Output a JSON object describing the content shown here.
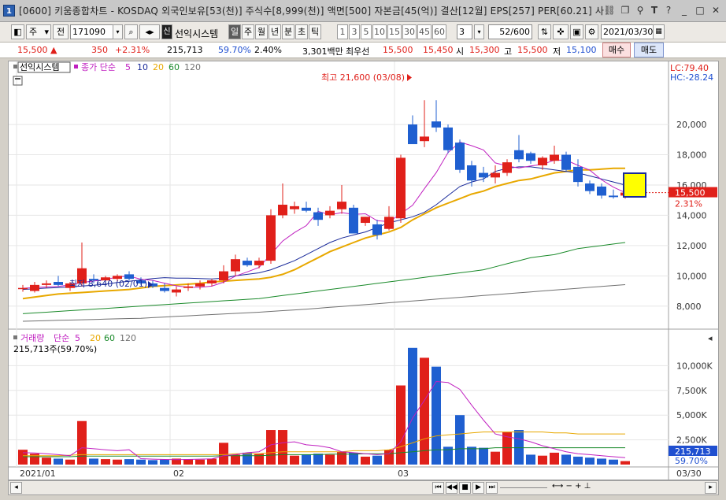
{
  "window": {
    "number_badge": "1",
    "title": "[0600] 키움종합차트 - KOSDAQ 외국인보유[53(천)] 주식수[8,999(천)] 액면[500] 자본금[45(억)] 결산[12월] EPS[257] PER[60.21] 사"
  },
  "toolbar": {
    "period_select": "주",
    "prev_label": "전",
    "code_value": "171090",
    "signal_badge": "신",
    "system_label": "선익시스템",
    "period_tabs": [
      "일",
      "주",
      "월",
      "년",
      "분",
      "초",
      "틱"
    ],
    "selected_period": "일",
    "interval_buttons": [
      "1",
      "3",
      "5",
      "10",
      "15",
      "30",
      "45",
      "60"
    ],
    "interval_value": "3",
    "count_value": "52",
    "count_total": "/600",
    "date_value": "2021/03/30"
  },
  "pricebar": {
    "price": "15,500",
    "change": "350",
    "change_pct": "+2.31%",
    "volume": "215,713",
    "volume_ratio": "59.70%",
    "turnover": "2.40%",
    "amount": "3,301백만",
    "best_ask_label": "최우선",
    "best_ask": "15,500",
    "best_bid": "15,450",
    "open_label": "시",
    "open": "15,300",
    "high_label": "고",
    "high": "15,500",
    "low_label": "저",
    "low": "15,100",
    "buy_label": "매수",
    "sell_label": "매도"
  },
  "legend": {
    "price_name": "선익시스템",
    "price_ma_label": "종가 단순",
    "ma_periods": [
      "5",
      "10",
      "20",
      "60",
      "120"
    ],
    "volume_name": "거래량",
    "volume_ma_label": "단순",
    "volume_current": "215,713주(59.70%)"
  },
  "annotations": {
    "high_label": "최고 21,600 (03/08)",
    "low_label": "최저 8,640 (02/01)",
    "lc_label": "LC:79.40",
    "hc_label": "HC:-28.24",
    "current_price_tag": "15,500",
    "current_pct_tag": "2.31%",
    "current_volume_tag": "215,713",
    "current_vol_pct_tag": "59.70%"
  },
  "x_axis": {
    "labels": [
      "2021/01",
      "02",
      "03"
    ],
    "end_label": "03/30"
  },
  "colors": {
    "up": "#e0201a",
    "down": "#1f5fd0",
    "ma5": "#c020c0",
    "ma10": "#1a2a9a",
    "ma20": "#e8a800",
    "ma60": "#1a8a2a",
    "ma120": "#707070"
  },
  "chart_data": {
    "type": "candlestick",
    "price_axis": {
      "ticks": [
        8000,
        10000,
        12000,
        14000,
        16000,
        18000,
        20000
      ],
      "ylim": [
        7000,
        22500
      ]
    },
    "volume_axis": {
      "ticks": [
        2500,
        5000,
        7500,
        10000
      ],
      "unit": "K",
      "ylim": [
        0,
        12500
      ]
    },
    "candles": [
      {
        "o": 9150,
        "h": 9400,
        "l": 8950,
        "c": 9200
      },
      {
        "o": 9000,
        "h": 9600,
        "l": 8900,
        "c": 9400
      },
      {
        "o": 9400,
        "h": 9700,
        "l": 9200,
        "c": 9500
      },
      {
        "o": 9600,
        "h": 10000,
        "l": 9300,
        "c": 9400
      },
      {
        "o": 9200,
        "h": 9600,
        "l": 9000,
        "c": 9500
      },
      {
        "o": 9500,
        "h": 12200,
        "l": 9300,
        "c": 10500
      },
      {
        "o": 9800,
        "h": 10100,
        "l": 9500,
        "c": 9700
      },
      {
        "o": 9700,
        "h": 10000,
        "l": 9500,
        "c": 9900
      },
      {
        "o": 9800,
        "h": 10100,
        "l": 9600,
        "c": 10000
      },
      {
        "o": 10100,
        "h": 10300,
        "l": 9700,
        "c": 9800
      },
      {
        "o": 9700,
        "h": 9900,
        "l": 9400,
        "c": 9500
      },
      {
        "o": 9500,
        "h": 9700,
        "l": 9200,
        "c": 9300
      },
      {
        "o": 9200,
        "h": 9500,
        "l": 8900,
        "c": 9000
      },
      {
        "o": 8900,
        "h": 9300,
        "l": 8640,
        "c": 9100
      },
      {
        "o": 9200,
        "h": 9500,
        "l": 9000,
        "c": 9300
      },
      {
        "o": 9300,
        "h": 9700,
        "l": 9100,
        "c": 9500
      },
      {
        "o": 9500,
        "h": 9800,
        "l": 9300,
        "c": 9700
      },
      {
        "o": 9700,
        "h": 10700,
        "l": 9500,
        "c": 10300
      },
      {
        "o": 10300,
        "h": 11400,
        "l": 10000,
        "c": 11100
      },
      {
        "o": 11000,
        "h": 11200,
        "l": 10600,
        "c": 10700
      },
      {
        "o": 10700,
        "h": 11200,
        "l": 10500,
        "c": 11000
      },
      {
        "o": 11000,
        "h": 14400,
        "l": 10800,
        "c": 14000
      },
      {
        "o": 14000,
        "h": 16100,
        "l": 13800,
        "c": 14700
      },
      {
        "o": 14400,
        "h": 14900,
        "l": 14100,
        "c": 14600
      },
      {
        "o": 14500,
        "h": 14900,
        "l": 14200,
        "c": 14300
      },
      {
        "o": 14200,
        "h": 14500,
        "l": 13300,
        "c": 13700
      },
      {
        "o": 14000,
        "h": 14600,
        "l": 13800,
        "c": 14300
      },
      {
        "o": 14400,
        "h": 16000,
        "l": 14100,
        "c": 14900
      },
      {
        "o": 14500,
        "h": 14700,
        "l": 12800,
        "c": 12800
      },
      {
        "o": 13500,
        "h": 13900,
        "l": 13300,
        "c": 13900
      },
      {
        "o": 13400,
        "h": 13700,
        "l": 12400,
        "c": 12700
      },
      {
        "o": 13100,
        "h": 14600,
        "l": 13000,
        "c": 13900
      },
      {
        "o": 13800,
        "h": 18000,
        "l": 13500,
        "c": 17800
      },
      {
        "o": 20000,
        "h": 20600,
        "l": 18700,
        "c": 18700
      },
      {
        "o": 18900,
        "h": 21600,
        "l": 18500,
        "c": 19200
      },
      {
        "o": 20200,
        "h": 21600,
        "l": 19500,
        "c": 19800
      },
      {
        "o": 19800,
        "h": 20000,
        "l": 18100,
        "c": 18300
      },
      {
        "o": 18800,
        "h": 19000,
        "l": 16800,
        "c": 17000
      },
      {
        "o": 17300,
        "h": 17600,
        "l": 15900,
        "c": 16300
      },
      {
        "o": 16800,
        "h": 17200,
        "l": 16200,
        "c": 16500
      },
      {
        "o": 16500,
        "h": 17300,
        "l": 16100,
        "c": 16800
      },
      {
        "o": 16800,
        "h": 17700,
        "l": 16600,
        "c": 17500
      },
      {
        "o": 18300,
        "h": 19300,
        "l": 17500,
        "c": 17700
      },
      {
        "o": 18100,
        "h": 18200,
        "l": 17400,
        "c": 17600
      },
      {
        "o": 17300,
        "h": 17900,
        "l": 17000,
        "c": 17800
      },
      {
        "o": 17600,
        "h": 18600,
        "l": 17400,
        "c": 18000
      },
      {
        "o": 18000,
        "h": 18200,
        "l": 16900,
        "c": 17000
      },
      {
        "o": 17200,
        "h": 17700,
        "l": 15900,
        "c": 16200
      },
      {
        "o": 16100,
        "h": 16300,
        "l": 15400,
        "c": 15600
      },
      {
        "o": 15900,
        "h": 16100,
        "l": 15100,
        "c": 15300
      },
      {
        "o": 15300,
        "h": 15700,
        "l": 15100,
        "c": 15200
      },
      {
        "o": 15300,
        "h": 15500,
        "l": 15100,
        "c": 15500
      }
    ],
    "volume": [
      1500,
      1100,
      700,
      600,
      500,
      4400,
      600,
      550,
      500,
      550,
      500,
      450,
      500,
      600,
      550,
      500,
      600,
      2200,
      1000,
      1200,
      1100,
      3500,
      3500,
      900,
      1000,
      1100,
      1000,
      1300,
      1200,
      800,
      900,
      1500,
      8000,
      11800,
      10800,
      9900,
      1800,
      5000,
      1800,
      1700,
      1300,
      3300,
      3500,
      1000,
      900,
      1200,
      1000,
      800,
      700,
      600,
      500,
      350
    ],
    "ma_lines": {
      "ma5": [
        9180,
        9230,
        9270,
        9300,
        9400,
        9560,
        9660,
        9740,
        9940,
        9980,
        9780,
        9700,
        9520,
        9340,
        9240,
        9240,
        9320,
        9580,
        9980,
        10260,
        10560,
        11420,
        12300,
        12860,
        13320,
        14260,
        14040,
        14180,
        14060,
        14100,
        13640,
        13580,
        14100,
        14660,
        15760,
        16820,
        18140,
        18840,
        18600,
        18320,
        17460,
        17260,
        17120,
        17260,
        17360,
        17640,
        17640,
        17300,
        16980,
        16340,
        15860,
        15500
      ],
      "ma10": [
        9100,
        9150,
        9190,
        9220,
        9270,
        9330,
        9380,
        9450,
        9560,
        9640,
        9730,
        9820,
        9880,
        9850,
        9850,
        9820,
        9800,
        9850,
        10000,
        10100,
        10200,
        10400,
        10700,
        11000,
        11400,
        11800,
        12200,
        12500,
        12700,
        12900,
        13200,
        13500,
        13700,
        13900,
        14200,
        14700,
        15300,
        15900,
        16200,
        16400,
        16900,
        17100,
        17200,
        17200,
        17100,
        17000,
        16900,
        16800,
        16600,
        16400,
        16200,
        16000
      ],
      "ma20": [
        8500,
        8600,
        8700,
        8800,
        8850,
        8900,
        8950,
        9000,
        9050,
        9100,
        9200,
        9300,
        9350,
        9400,
        9450,
        9500,
        9600,
        9650,
        9700,
        9750,
        9800,
        9900,
        10100,
        10400,
        10800,
        11200,
        11600,
        11900,
        12200,
        12500,
        12700,
        12900,
        13200,
        13700,
        14100,
        14500,
        14800,
        15100,
        15400,
        15600,
        15900,
        16100,
        16300,
        16400,
        16600,
        16800,
        16900,
        17000,
        17000,
        17050,
        17100,
        17100
      ],
      "ma60": [
        7500,
        7550,
        7600,
        7650,
        7700,
        7750,
        7800,
        7850,
        7900,
        7950,
        8000,
        8050,
        8100,
        8150,
        8200,
        8250,
        8300,
        8350,
        8400,
        8450,
        8500,
        8600,
        8700,
        8800,
        8900,
        9000,
        9100,
        9200,
        9300,
        9400,
        9500,
        9600,
        9700,
        9800,
        9900,
        10000,
        10100,
        10200,
        10300,
        10400,
        10600,
        10800,
        11000,
        11200,
        11300,
        11400,
        11600,
        11800,
        11900,
        12000,
        12100,
        12200
      ],
      "ma120": [
        7000,
        7020,
        7040,
        7060,
        7080,
        7100,
        7120,
        7140,
        7160,
        7180,
        7200,
        7240,
        7280,
        7320,
        7360,
        7400,
        7440,
        7480,
        7520,
        7560,
        7600,
        7650,
        7700,
        7750,
        7800,
        7860,
        7920,
        7980,
        8040,
        8100,
        8160,
        8220,
        8280,
        8340,
        8400,
        8460,
        8520,
        8580,
        8640,
        8700,
        8760,
        8820,
        8880,
        8940,
        9000,
        9060,
        9120,
        9180,
        9240,
        9300,
        9360,
        9420
      ]
    },
    "volume_ma5": [
      1200,
      1180,
      1100,
      1000,
      900,
      1700,
      1600,
      1500,
      1400,
      1500,
      600,
      550,
      520,
      500,
      520,
      550,
      580,
      900,
      1000,
      1200,
      1300,
      2000,
      2200,
      2300,
      2000,
      1900,
      1700,
      1300,
      1200,
      1100,
      1000,
      1100,
      2300,
      4700,
      6500,
      8400,
      8300,
      7600,
      6000,
      4500,
      3100,
      2800,
      2600,
      2300,
      1900,
      1600,
      1300,
      1100,
      1000,
      900,
      800,
      700
    ],
    "volume_ma20": [
      900,
      900,
      900,
      900,
      950,
      1000,
      1000,
      1000,
      1000,
      1000,
      1000,
      1000,
      1000,
      1000,
      1000,
      1000,
      1000,
      1000,
      1100,
      1100,
      1100,
      1200,
      1300,
      1300,
      1300,
      1300,
      1300,
      1300,
      1400,
      1400,
      1400,
      1500,
      1800,
      2200,
      2600,
      2900,
      3000,
      3100,
      3200,
      3300,
      3300,
      3300,
      3300,
      3300,
      3300,
      3200,
      3200,
      3100,
      3100,
      3100,
      3100,
      3100
    ],
    "volume_ma60": [
      800,
      800,
      800,
      800,
      800,
      850,
      850,
      850,
      850,
      850,
      850,
      850,
      850,
      850,
      850,
      850,
      850,
      900,
      900,
      900,
      900,
      950,
      1000,
      1000,
      1000,
      1000,
      1050,
      1050,
      1050,
      1100,
      1100,
      1100,
      1200,
      1300,
      1400,
      1500,
      1500,
      1600,
      1600,
      1600,
      1700,
      1700,
      1700,
      1700,
      1700,
      1700,
      1700,
      1700,
      1700,
      1700,
      1700,
      1700
    ]
  }
}
